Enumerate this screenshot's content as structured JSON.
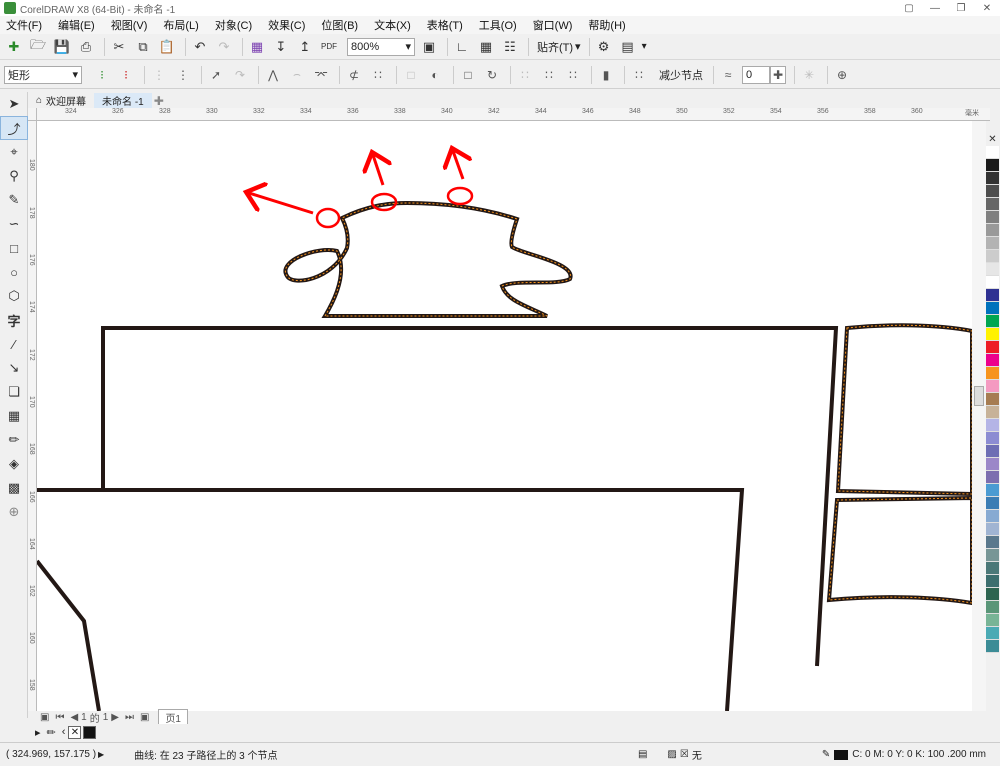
{
  "window": {
    "title": "CorelDRAW X8 (64-Bit) - 未命名 -1"
  },
  "menu": [
    "文件(F)",
    "编辑(E)",
    "视图(V)",
    "布局(L)",
    "对象(C)",
    "效果(C)",
    "位图(B)",
    "文本(X)",
    "表格(T)",
    "工具(O)",
    "窗口(W)",
    "帮助(H)"
  ],
  "toolbar": {
    "pdf_label": "PDF",
    "zoom_value": "800%",
    "snap_label": "贴齐(T)"
  },
  "property_bar": {
    "shape_type": "矩形",
    "reduce_nodes": "减少节点",
    "smoothness": "0"
  },
  "tabs": {
    "welcome": "欢迎屏幕",
    "doc": "未命名 -1"
  },
  "ruler": {
    "top_ticks": [
      "324",
      "326",
      "328",
      "330",
      "332",
      "334",
      "336",
      "338",
      "340",
      "342",
      "344",
      "346",
      "348",
      "350",
      "352",
      "354",
      "356",
      "358",
      "360"
    ],
    "unit": "毫米",
    "left_ticks": [
      "180",
      "178",
      "176",
      "174",
      "172",
      "170",
      "168",
      "166",
      "164",
      "162",
      "160",
      "158"
    ]
  },
  "page_nav": {
    "current": "1",
    "of": "的",
    "total": "1",
    "page_tab": "页1"
  },
  "status": {
    "coords": "( 324.969, 157.175 )",
    "description": "曲线: 在 23 子路径上的 3 个节点",
    "fill_label": "无",
    "outline_info": "C: 0 M: 0 Y: 0 K: 100  .200 mm"
  },
  "palette_colors": [
    "#ffffff",
    "#1a1a1a",
    "#333333",
    "#4d4d4d",
    "#666666",
    "#808080",
    "#999999",
    "#b3b3b3",
    "#cccccc",
    "#e6e6e6",
    "#ffffff",
    "#2e3192",
    "#0072bc",
    "#00a651",
    "#fff200",
    "#ed1c24",
    "#ec008c",
    "#f7941d",
    "#f49ac1",
    "#a67c52",
    "#c7b299",
    "#b4b4e6",
    "#8c8cd2",
    "#6e6eb4",
    "#9b87c8",
    "#7d6eaf",
    "#4b9bd2",
    "#3c7db4",
    "#87aad2",
    "#a0b4d2",
    "#5a788c",
    "#789696",
    "#4b7878",
    "#3c6e6e",
    "#2d6450",
    "#5a9678",
    "#78b496",
    "#4baab4",
    "#3c8c96"
  ],
  "colors": {
    "accent": "#8ab4dd",
    "annotation_red": "#ff0000",
    "stroke_dark": "#231815",
    "dash_orange": "#f7941d"
  },
  "icons": [
    "pick-tool-icon",
    "shape-tool-icon",
    "crop-tool-icon",
    "zoom-tool-icon",
    "freehand-tool-icon",
    "artistic-media-icon",
    "rectangle-tool-icon",
    "ellipse-tool-icon",
    "polygon-tool-icon",
    "text-tool-icon",
    "parallel-dimension-icon",
    "connector-tool-icon",
    "drop-shadow-icon",
    "transparency-tool-icon",
    "eyedropper-icon",
    "interactive-fill-icon",
    "smart-fill-icon",
    "add-tool-icon"
  ]
}
